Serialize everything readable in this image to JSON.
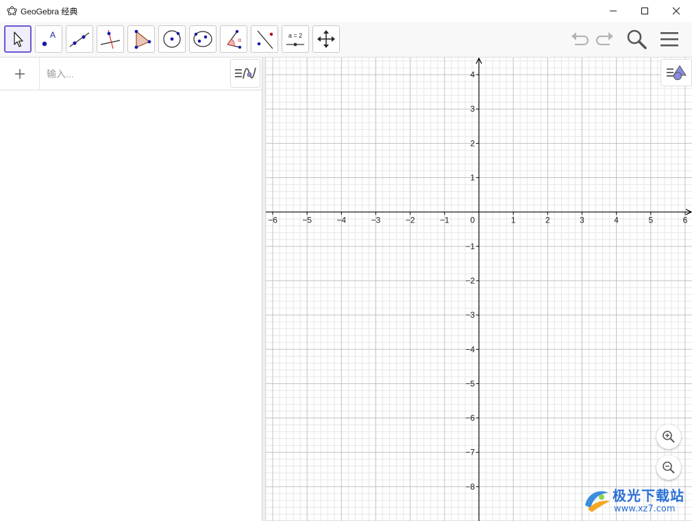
{
  "window": {
    "title": "GeoGebra 经典"
  },
  "toolbar": {
    "tools": [
      {
        "name": "move",
        "icon": "arrow-cursor-icon"
      },
      {
        "name": "point",
        "icon": "point-icon",
        "label": "A"
      },
      {
        "name": "line",
        "icon": "line-through-two-points-icon"
      },
      {
        "name": "perpendicular-line",
        "icon": "perpendicular-line-icon"
      },
      {
        "name": "polygon",
        "icon": "polygon-icon"
      },
      {
        "name": "circle",
        "icon": "circle-with-center-icon"
      },
      {
        "name": "ellipse",
        "icon": "ellipse-icon"
      },
      {
        "name": "angle",
        "icon": "angle-icon",
        "label": "α"
      },
      {
        "name": "reflect",
        "icon": "reflect-about-line-icon"
      },
      {
        "name": "slider",
        "icon": "slider-icon",
        "label": "a = 2"
      },
      {
        "name": "move-graphics-view",
        "icon": "move-graphics-view-icon"
      }
    ],
    "selected_tool": "move",
    "right": [
      "undo-icon",
      "redo-icon",
      "search-icon",
      "menu-icon"
    ]
  },
  "algebra": {
    "add_label": "+",
    "input_placeholder": "输入..."
  },
  "watermark": {
    "title": "极光下载站",
    "url": "www.xz7.com"
  },
  "colors": {
    "accent": "#6557d2",
    "point": "#1a1aa8",
    "grid_major": "#c0c0c0",
    "grid_minor": "#e6e6e6",
    "axis": "#000000"
  },
  "chart_data": {
    "type": "scatter",
    "title": "",
    "xlabel": "",
    "ylabel": "",
    "xlim": [
      -6.2,
      6.2
    ],
    "ylim": [
      -9,
      4.5
    ],
    "x_ticks": [
      -6,
      -5,
      -4,
      -3,
      -2,
      -1,
      0,
      1,
      2,
      3,
      4,
      5,
      6
    ],
    "y_ticks": [
      -8,
      -7,
      -6,
      -5,
      -4,
      -3,
      -2,
      -1,
      1,
      2,
      3,
      4
    ],
    "x_tick_labels": [
      "−6",
      "−5",
      "−4",
      "−3",
      "−2",
      "−1",
      "0",
      "1",
      "2",
      "3",
      "4",
      "5",
      "6"
    ],
    "y_tick_labels": [
      "−8",
      "−7",
      "−6",
      "−5",
      "−4",
      "−3",
      "−2",
      "−1",
      "1",
      "2",
      "3",
      "4"
    ],
    "minor_per_major": 5,
    "grid": true,
    "series": []
  }
}
